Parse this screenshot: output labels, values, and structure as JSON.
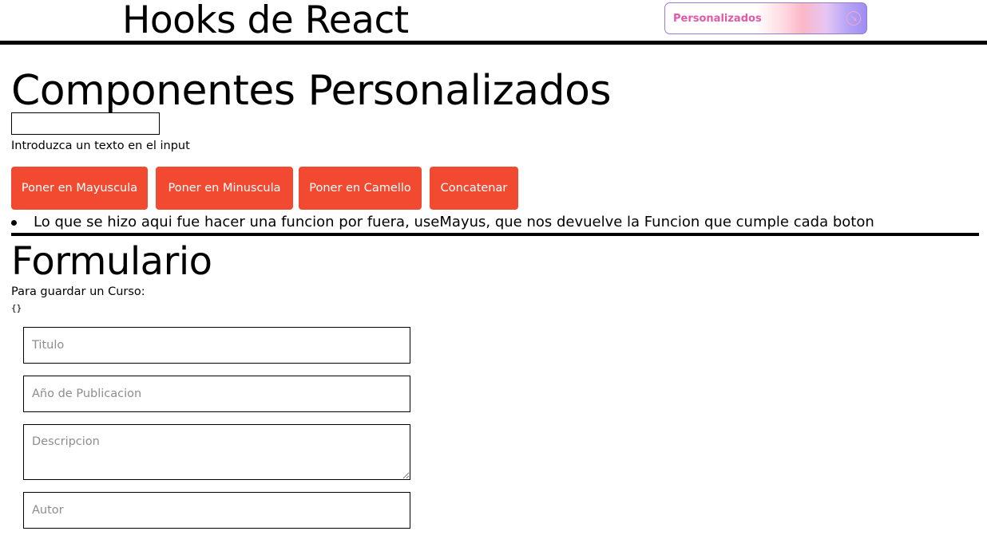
{
  "header": {
    "title": "Hooks de React",
    "nav_button": {
      "label": "Personalizados",
      "icon": "arrow-circle-icon",
      "label_color": "#e15aa6",
      "border_color": "#9b7ad8"
    }
  },
  "custom_section": {
    "title": "Componentes Personalizados",
    "input_value": "",
    "input_hint": "Introduzca un texto en el input",
    "buttons": [
      "Poner en Mayuscula",
      "Poner en Minuscula",
      "Poner en Camello",
      "Concatenar"
    ],
    "button_color": "#f24a30",
    "bullets": [
      "Lo que se hizo aqui fue hacer una funcion por fuera, useMayus, que nos devuelve la Funcion que cumple cada boton"
    ]
  },
  "form_section": {
    "title": "Formulario",
    "caption": "Para guardar un Curso:",
    "state_dump": "{}",
    "fields": {
      "titulo_placeholder": "Titulo",
      "anio_placeholder": "Año de Publicacion",
      "descripcion_placeholder": "Descripcion",
      "autor_placeholder": "Autor"
    }
  }
}
